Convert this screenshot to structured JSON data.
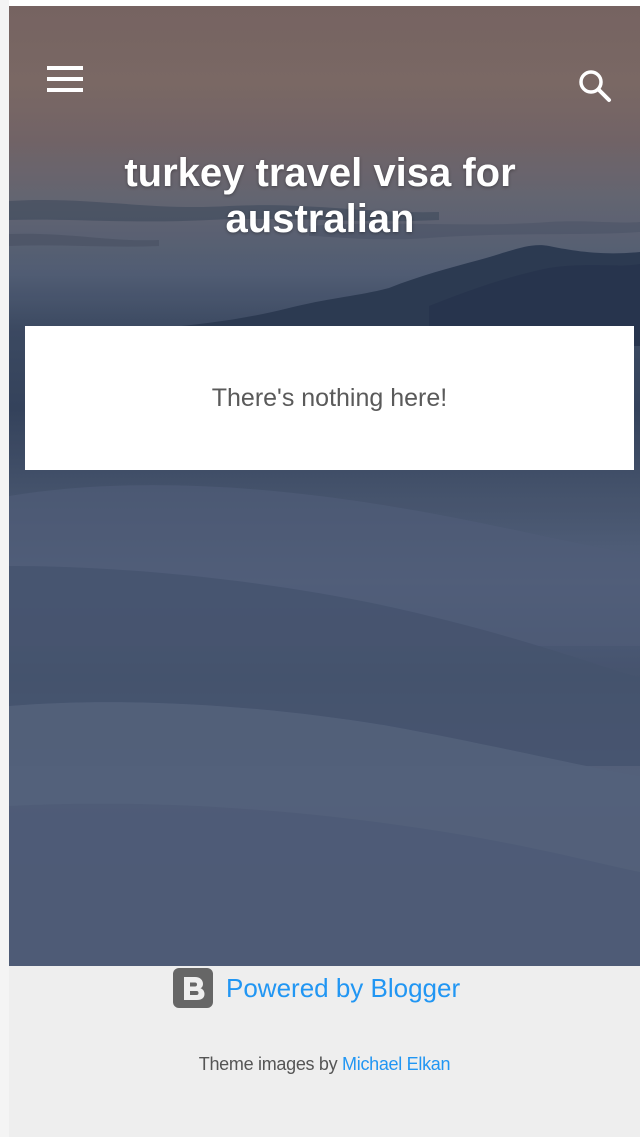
{
  "header": {
    "menu_icon": "hamburger-menu-icon",
    "search_icon": "search-icon",
    "title": "turkey travel visa for australian"
  },
  "main": {
    "empty_message": "There's nothing here!"
  },
  "footer": {
    "powered_by_icon": "blogger-logo-icon",
    "powered_by_label": "Powered by Blogger",
    "theme_credit_prefix": "Theme images by",
    "theme_credit_author": "Michael Elkan"
  },
  "colors": {
    "link": "#2196f3",
    "footer_background": "#eeeeee",
    "title_text": "#ffffff",
    "card_background": "#ffffff"
  }
}
